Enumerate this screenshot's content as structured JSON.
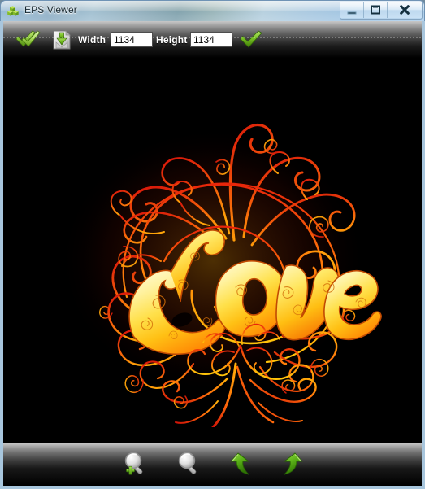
{
  "window": {
    "title": "EPS Viewer",
    "app_icon": "green-cubes-icon",
    "controls": [
      {
        "name": "minimize-button",
        "icon": "minimize-icon",
        "label": "Minimize"
      },
      {
        "name": "maximize-button",
        "icon": "maximize-icon",
        "label": "Maximize"
      },
      {
        "name": "close-button",
        "icon": "close-icon",
        "label": "Close"
      }
    ]
  },
  "toolbar_top": {
    "open_icon": "green-double-check-icon",
    "save_icon": "save-document-download-icon",
    "width_label": "Width",
    "width_value": "1134",
    "height_label": "Height",
    "height_value": "1134",
    "apply_icon": "green-check-icon"
  },
  "canvas": {
    "background": "#000000",
    "artwork_title": "Love",
    "artwork_description": "Ornate swirling calligraphic Love lettering with filigree flourishes",
    "colors": {
      "text_light": "#fff7b0",
      "text_yellow": "#ffd21e",
      "text_orange": "#ff8a00",
      "swirl_orange": "#ff6a00",
      "swirl_red": "#e01b0a",
      "outline": "#b01000"
    }
  },
  "toolbar_bottom": {
    "buttons": [
      {
        "name": "zoom-in-button",
        "icon": "magnifier-plus-icon",
        "label": "Zoom In"
      },
      {
        "name": "zoom-out-button",
        "icon": "magnifier-icon",
        "label": "Zoom Out"
      },
      {
        "name": "rotate-left-button",
        "icon": "arrow-rotate-left-icon",
        "label": "Rotate Left"
      },
      {
        "name": "rotate-right-button",
        "icon": "arrow-rotate-right-icon",
        "label": "Rotate Right"
      }
    ]
  }
}
